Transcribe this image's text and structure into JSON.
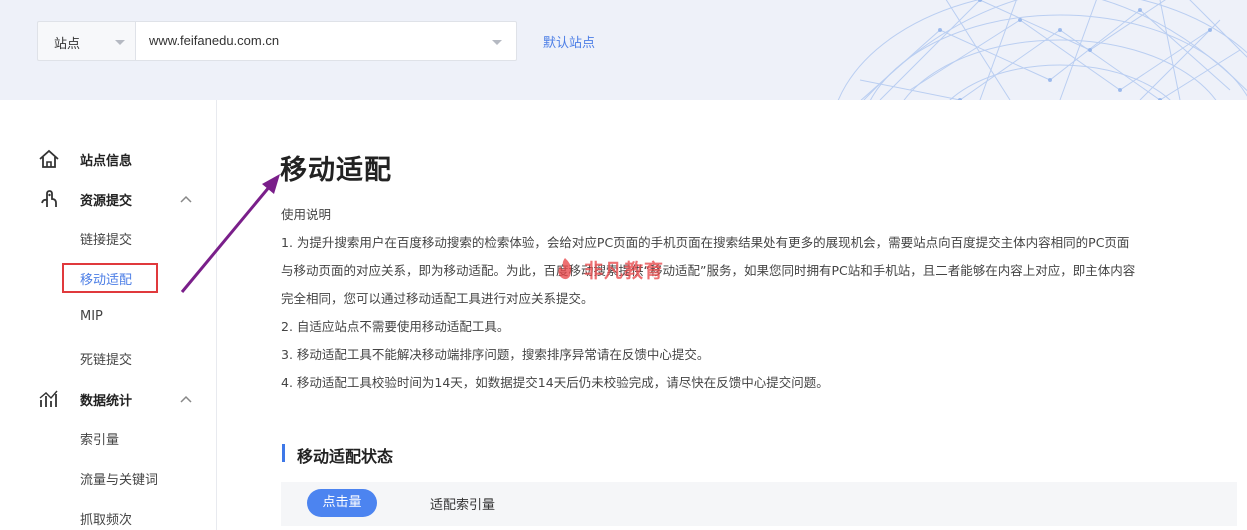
{
  "header": {
    "site_selector": {
      "label": "站点"
    },
    "url_selector": {
      "value": "www.feifanedu.com.cn"
    },
    "default_site_link": "默认站点"
  },
  "sidebar": {
    "groups": [
      {
        "title": "站点信息",
        "icon": "home-icon"
      },
      {
        "title": "资源提交",
        "icon": "hand-pointer-icon",
        "items": [
          "链接提交",
          "移动适配",
          "MIP",
          "死链提交"
        ]
      },
      {
        "title": "数据统计",
        "icon": "bar-chart-icon",
        "items": [
          "索引量",
          "流量与关键词",
          "抓取频次"
        ]
      }
    ],
    "active_item": "移动适配"
  },
  "main": {
    "title": "移动适配",
    "usage_title": "使用说明",
    "lines": [
      "1. 为提升搜索用户在百度移动搜索的检索体验，会给对应PC页面的手机页面在搜索结果处有更多的展现机会，需要站点向百度提交主体内容相同的PC页面",
      "与移动页面的对应关系，即为移动适配。为此，百度移动搜索提供“移动适配”服务，如果您同时拥有PC站和手机站，且二者能够在内容上对应，即主体内容",
      "完全相同，您可以通过移动适配工具进行对应关系提交。",
      "2. 自适应站点不需要使用移动适配工具。",
      "3. 移动适配工具不能解决移动端排序问题，搜索排序异常请在反馈中心提交。",
      "4. 移动适配工具校验时间为14天，如数据提交14天后仍未校验完成，请尽快在反馈中心提交问题。"
    ],
    "section_title": "移动适配状态",
    "tabs": [
      "点击量",
      "适配索引量"
    ],
    "active_tab": "点击量"
  },
  "watermark": {
    "text": "非凡教育"
  },
  "colors": {
    "accent": "#4c84f0",
    "link": "#4c7ee6",
    "highlight_box": "#e0393c",
    "arrow": "#7a1f8a",
    "header_bg": "#eef1f9"
  }
}
